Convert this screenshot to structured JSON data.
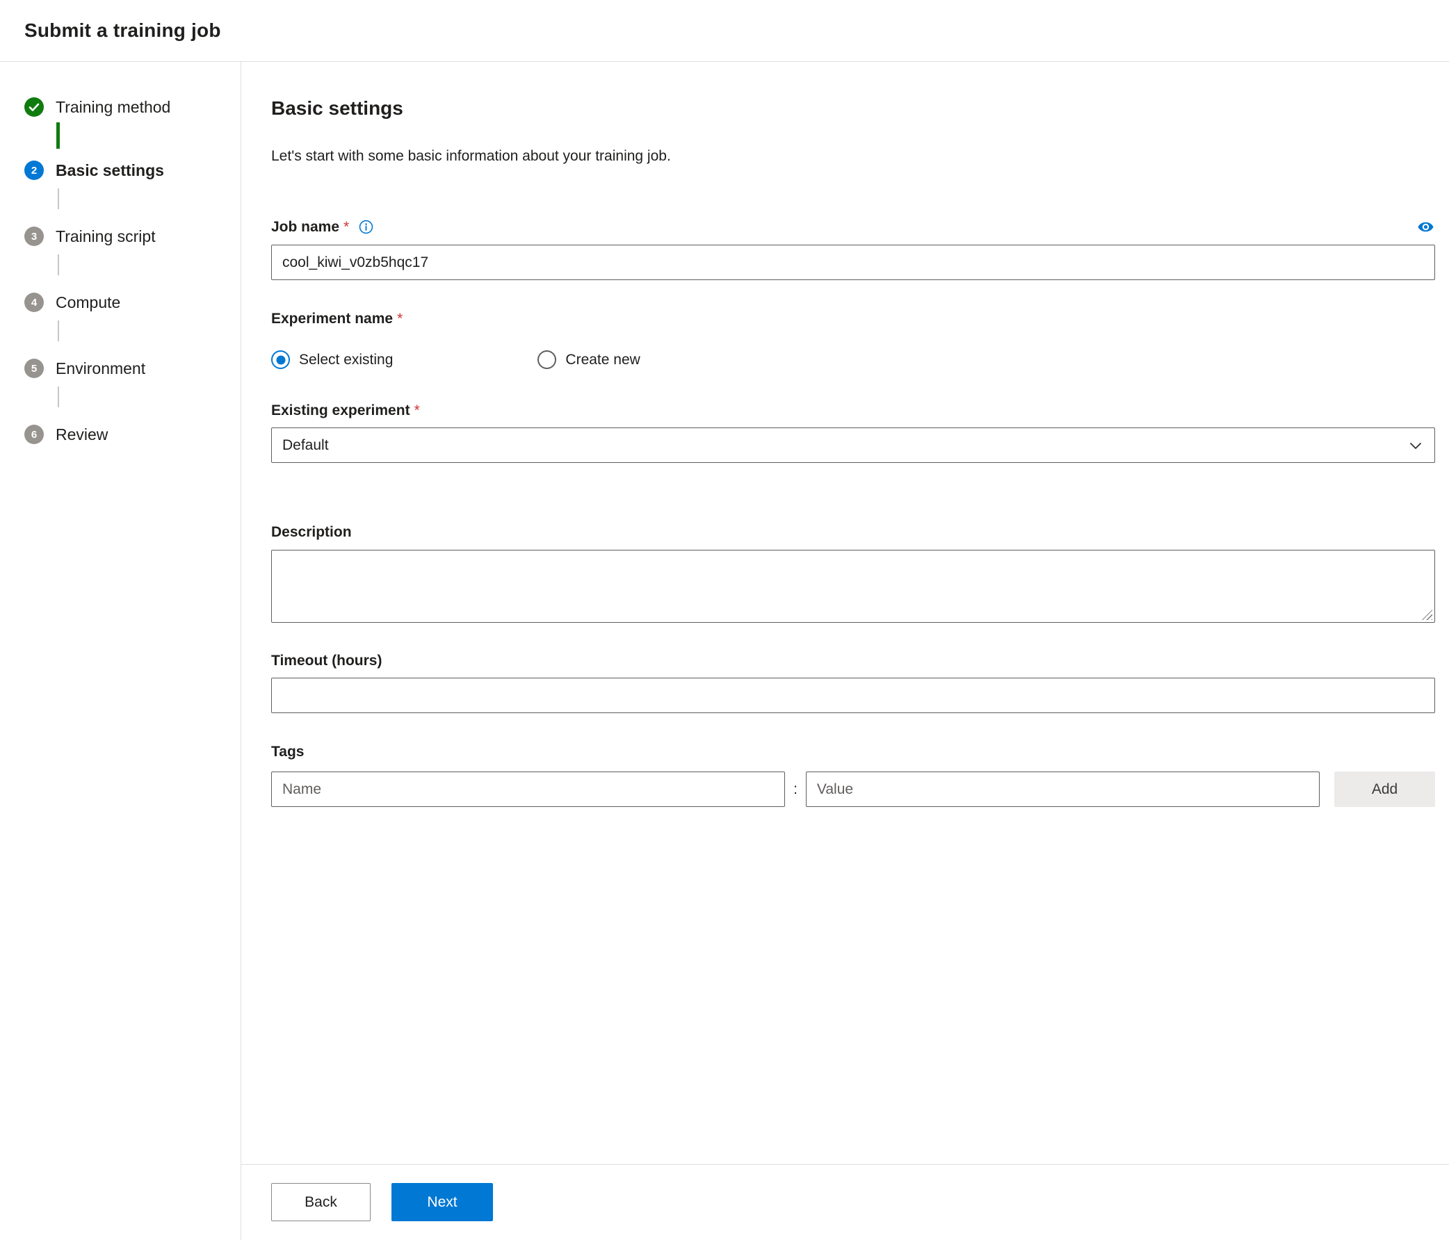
{
  "colors": {
    "accent": "#0078d4",
    "success": "#107c10",
    "required": "#d13438"
  },
  "header": {
    "title": "Submit a training job"
  },
  "stepper": {
    "steps": [
      {
        "label": "Training method",
        "state": "complete"
      },
      {
        "label": "Basic settings",
        "number": "2",
        "state": "current"
      },
      {
        "label": "Training script",
        "number": "3",
        "state": "upcoming"
      },
      {
        "label": "Compute",
        "number": "4",
        "state": "upcoming"
      },
      {
        "label": "Environment",
        "number": "5",
        "state": "upcoming"
      },
      {
        "label": "Review",
        "number": "6",
        "state": "upcoming"
      }
    ]
  },
  "main": {
    "title": "Basic settings",
    "subtitle": "Let's start with some basic information about your training job.",
    "required_marker": "*",
    "job_name": {
      "label": "Job name",
      "value": "cool_kiwi_v0zb5hqc17"
    },
    "experiment_name": {
      "label": "Experiment name",
      "options": [
        {
          "label": "Select existing",
          "selected": true
        },
        {
          "label": "Create new",
          "selected": false
        }
      ]
    },
    "existing_experiment": {
      "label": "Existing experiment",
      "value": "Default"
    },
    "description": {
      "label": "Description",
      "value": ""
    },
    "timeout": {
      "label": "Timeout (hours)",
      "value": ""
    },
    "tags": {
      "label": "Tags",
      "name_placeholder": "Name",
      "separator": ":",
      "value_placeholder": "Value",
      "add_label": "Add"
    }
  },
  "footer": {
    "back_label": "Back",
    "next_label": "Next"
  }
}
